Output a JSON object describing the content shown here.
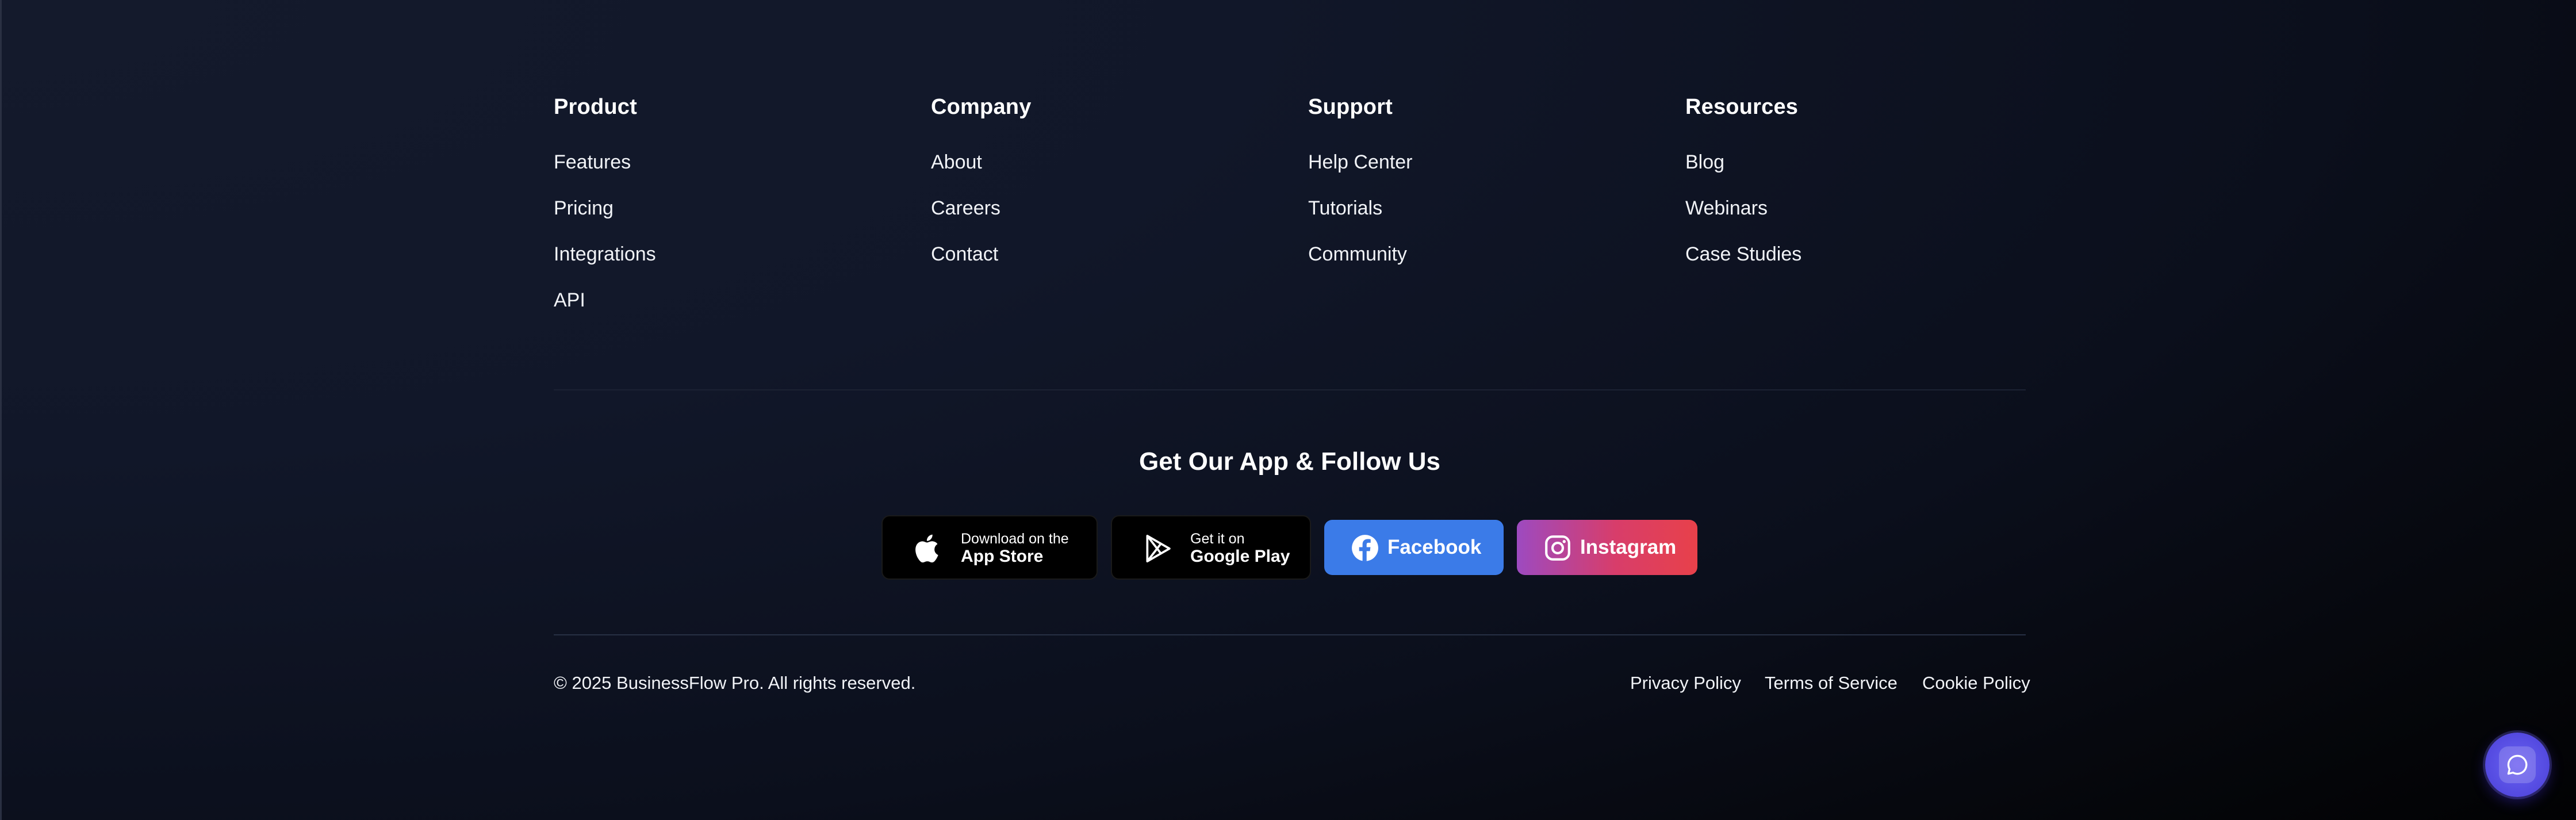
{
  "footer": {
    "columns": [
      {
        "title": "Product",
        "links": [
          "Features",
          "Pricing",
          "Integrations",
          "API"
        ]
      },
      {
        "title": "Company",
        "links": [
          "About",
          "Careers",
          "Contact"
        ]
      },
      {
        "title": "Support",
        "links": [
          "Help Center",
          "Tutorials",
          "Community"
        ]
      },
      {
        "title": "Resources",
        "links": [
          "Blog",
          "Webinars",
          "Case Studies"
        ]
      }
    ],
    "app_section": {
      "title": "Get Our App & Follow Us",
      "app_store": {
        "small": "Download on the",
        "big": "App Store"
      },
      "google_play": {
        "small": "Get it on",
        "big": "Google Play"
      },
      "facebook": "Facebook",
      "instagram": "Instagram"
    },
    "copyright": "© 2025 BusinessFlow Pro. All rights reserved.",
    "legal": [
      "Privacy Policy",
      "Terms of Service",
      "Cookie Policy"
    ]
  },
  "icons": {
    "app_store": "apple-icon",
    "google_play": "play-icon",
    "facebook": "facebook-icon",
    "instagram": "instagram-icon",
    "chat": "chat-bubble-icon"
  },
  "colors": {
    "background": "#111729",
    "facebook": "#3b7be8",
    "instagram_start": "#9d4ac0",
    "instagram_end": "#e8414a",
    "chat_button": "#5b52e6"
  }
}
